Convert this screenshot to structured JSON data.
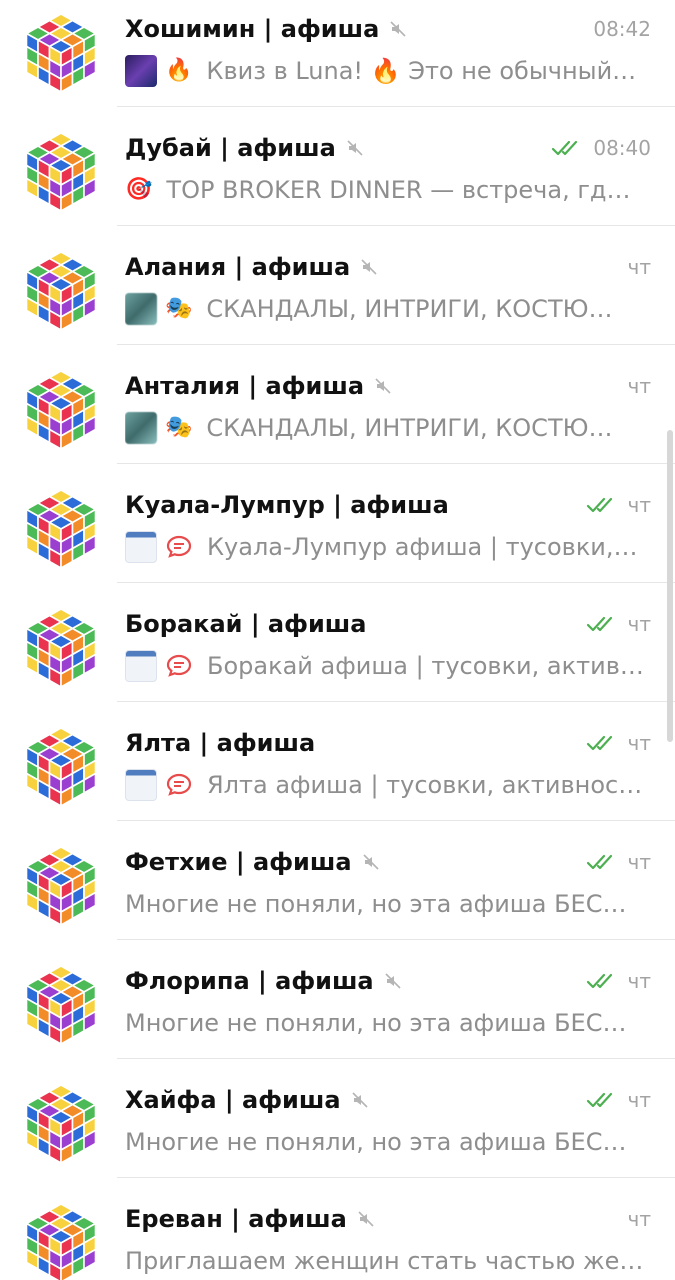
{
  "chats": [
    {
      "title": "Хошимин | афиша",
      "muted": true,
      "read": false,
      "time": "08:42",
      "media": [
        "night-photo-thumb",
        "fire-emoji"
      ],
      "preview": "Квиз в Luna! 🔥 Это не обычный…"
    },
    {
      "title": "Дубай | афиша",
      "muted": true,
      "read": true,
      "time": "08:40",
      "media": [
        "target-emoji"
      ],
      "preview": "TOP BROKER DINNER — встреча, гд…"
    },
    {
      "title": "Алания | афиша",
      "muted": true,
      "read": false,
      "time": "чт",
      "media": [
        "photo-thumb",
        "theater-masks-emoji"
      ],
      "preview": "СКАНДАЛЫ, ИНТРИГИ, КОСТЮ…"
    },
    {
      "title": "Анталия | афиша",
      "muted": true,
      "read": false,
      "time": "чт",
      "media": [
        "photo-thumb",
        "theater-masks-emoji"
      ],
      "preview": "СКАНДАЛЫ, ИНТРИГИ, КОСТЮ…"
    },
    {
      "title": "Куала-Лумпур | афиша",
      "muted": false,
      "read": true,
      "time": "чт",
      "media": [
        "link-thumb",
        "speech-bubble-icon"
      ],
      "preview": "Куала-Лумпур афиша | тусовки,…"
    },
    {
      "title": "Боракай | афиша",
      "muted": false,
      "read": true,
      "time": "чт",
      "media": [
        "link-thumb",
        "speech-bubble-icon"
      ],
      "preview": "Боракай афиша | тусовки, актив…"
    },
    {
      "title": "Ялта | афиша",
      "muted": false,
      "read": true,
      "time": "чт",
      "media": [
        "link-thumb",
        "speech-bubble-icon"
      ],
      "preview": "Ялта афиша | тусовки, активнос…"
    },
    {
      "title": "Фетхие | афиша",
      "muted": true,
      "read": true,
      "time": "чт",
      "media": [],
      "preview": "Многие не поняли, но эта афиша БЕС…"
    },
    {
      "title": "Флорипа | афиша",
      "muted": true,
      "read": true,
      "time": "чт",
      "media": [],
      "preview": "Многие не поняли, но эта афиша БЕС…"
    },
    {
      "title": "Хайфа | афиша",
      "muted": true,
      "read": true,
      "time": "чт",
      "media": [],
      "preview": "Многие не поняли, но эта афиша БЕС…"
    },
    {
      "title": "Ереван | афиша",
      "muted": true,
      "read": false,
      "time": "чт",
      "media": [],
      "preview": "Приглашаем женщин стать частью же…"
    }
  ],
  "colors": {
    "read_check": "#4caf50",
    "muted_icon": "#b5b5b5",
    "speech_bubble": "#e84b4b",
    "cube": [
      "#2b6cd8",
      "#e9334f",
      "#f7d23e",
      "#4cbb57",
      "#f28c28",
      "#9b3fd0"
    ]
  }
}
